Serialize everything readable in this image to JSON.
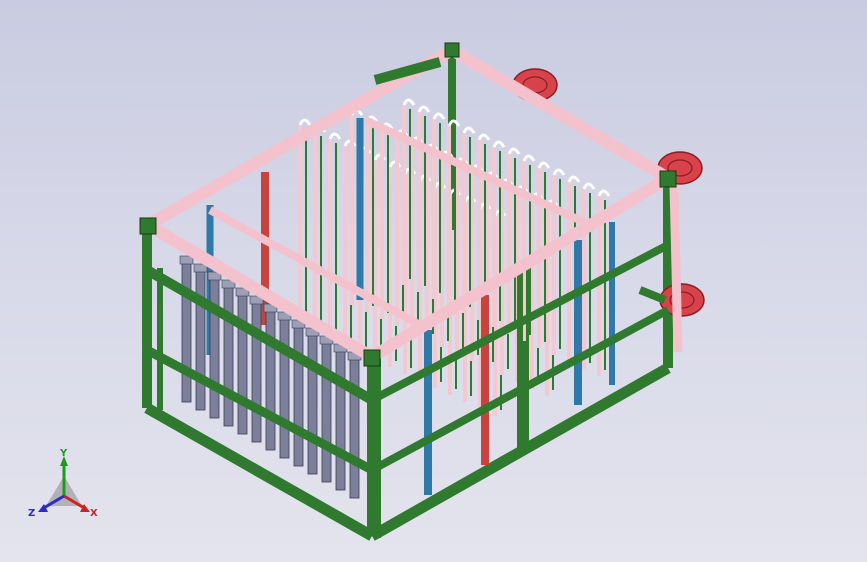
{
  "view": {
    "background_top": "#c9cbe0",
    "background_bottom": "#e4e4ee"
  },
  "model": {
    "frame_color": "#2f7a2f",
    "frame_edge": "#0f3d10",
    "rail_color": "#f3c2cc",
    "tube_color": "#f3c9cf",
    "post_blue": "#2e79a8",
    "post_red": "#c8423e",
    "reel_color": "#d8424a",
    "module_color": "#7c7f9a"
  },
  "triad": {
    "x_label": "X",
    "y_label": "Y",
    "z_label": "Z",
    "x_color": "#d12222",
    "y_color": "#1a9e1a",
    "z_color": "#2a2ad0",
    "icon": "coordinate-triad-icon"
  }
}
